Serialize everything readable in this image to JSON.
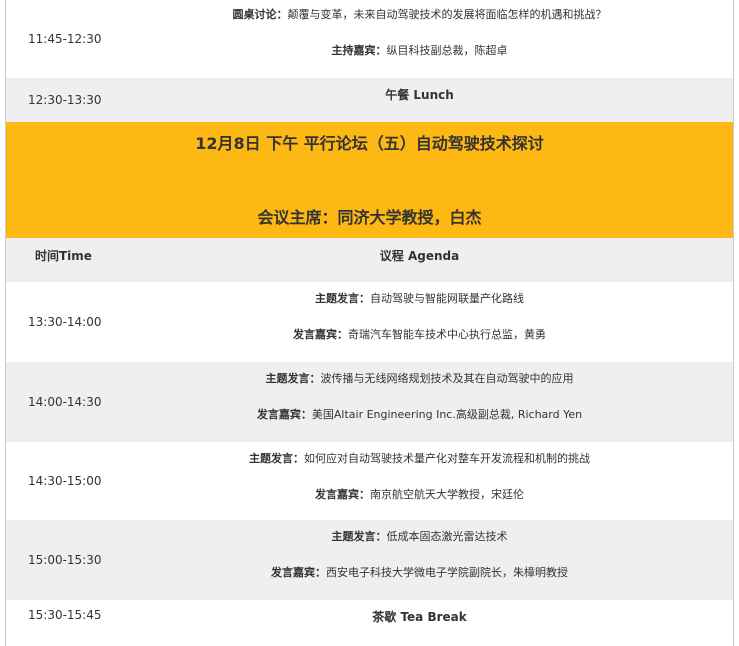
{
  "rows": [
    {
      "time": "11:45-12:30",
      "topic_label": "圆桌讨论：",
      "topic_text": "颠覆与变革，未来自动驾驶技术的发展将面临怎样的机遇和挑战？",
      "speaker_label": "主持嘉宾：",
      "speaker_text": "纵目科技副总裁，陈超卓"
    },
    {
      "time": "12:30-13:30",
      "title": "午餐 Lunch"
    }
  ],
  "banner": {
    "title": "12月8日 下午 平行论坛（五）自动驾驶技术探讨",
    "chair": "会议主席：同济大学教授，白杰"
  },
  "header": {
    "time_col": "时间Time",
    "agenda_col": "议程 Agenda"
  },
  "sessions": [
    {
      "time": "13:30-14:00",
      "topic_label": "主题发言：",
      "topic_text": "自动驾驶与智能网联量产化路线",
      "speaker_label": "发言嘉宾：",
      "speaker_text": "奇瑞汽车智能车技术中心执行总监，黄勇"
    },
    {
      "time": "14:00-14:30",
      "topic_label": "主题发言：",
      "topic_text": "波传播与无线网络规划技术及其在自动驾驶中的应用",
      "speaker_label": "发言嘉宾：",
      "speaker_text": "美国Altair Engineering Inc.高级副总裁, Richard Yen"
    },
    {
      "time": "14:30-15:00",
      "topic_label": "主题发言：",
      "topic_text": "如何应对自动驾驶技术量产化对整车开发流程和机制的挑战",
      "speaker_label": "发言嘉宾：",
      "speaker_text": "南京航空航天大学教授，宋廷伦"
    },
    {
      "time": "15:00-15:30",
      "topic_label": "主题发言：",
      "topic_text": "低成本固态激光雷达技术",
      "speaker_label": "发言嘉宾：",
      "speaker_text": "西安电子科技大学微电子学院副院长，朱樟明教授"
    }
  ],
  "break": {
    "time": "15:30-15:45",
    "title": "茶歇 Tea Break"
  },
  "colors": {
    "banner": "#fdb813",
    "gray_row": "#efefef"
  }
}
